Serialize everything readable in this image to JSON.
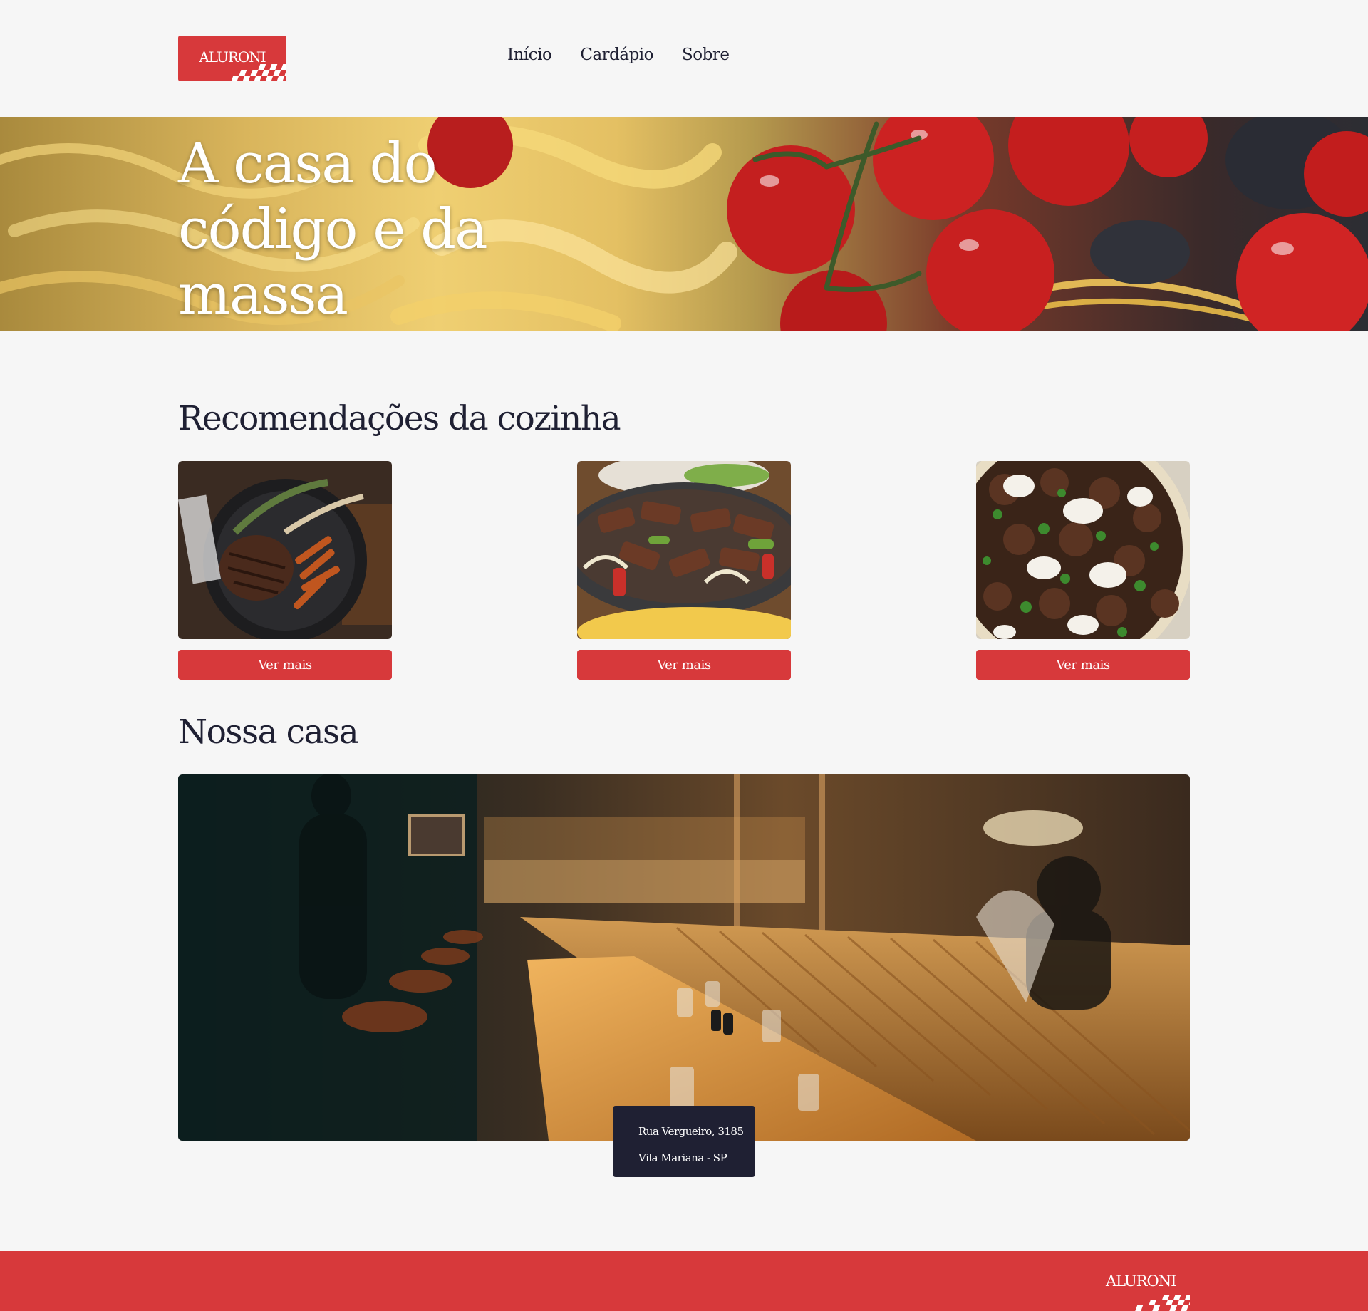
{
  "brand": {
    "logo_text": "ALURONI"
  },
  "nav": {
    "items": [
      "Início",
      "Cardápio",
      "Sobre"
    ]
  },
  "hero": {
    "title": "A casa do código e da massa"
  },
  "recommendations": {
    "title": "Recomendações da cozinha",
    "cards": [
      {
        "button_label": "Ver mais"
      },
      {
        "button_label": "Ver mais"
      },
      {
        "button_label": "Ver mais"
      }
    ]
  },
  "house": {
    "title": "Nossa casa",
    "address_line1": "Rua Vergueiro, 3185",
    "address_line2": "Vila Mariana - SP"
  },
  "footer": {
    "logo_text": "ALURONI"
  },
  "colors": {
    "accent": "#d7393b",
    "dark": "#1f2033",
    "background": "#f6f6f6"
  }
}
